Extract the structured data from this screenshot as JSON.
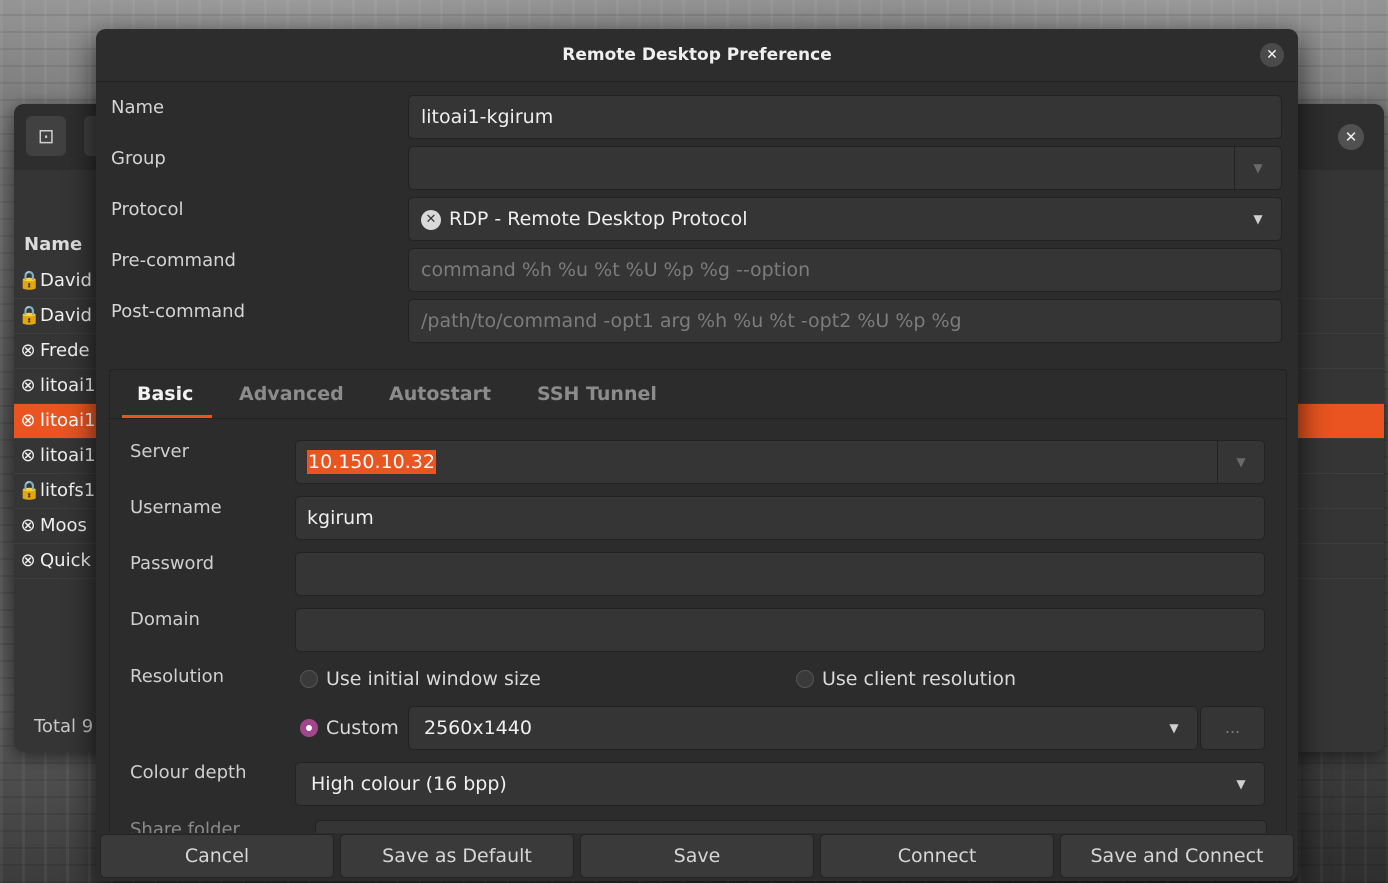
{
  "main_window": {
    "column_name": "Name",
    "rows": [
      {
        "icon": "🔒",
        "label": "David",
        "selected": false
      },
      {
        "icon": "🔒",
        "label": "David",
        "selected": false
      },
      {
        "icon": "⊗",
        "label": "Frede",
        "selected": false
      },
      {
        "icon": "⊗",
        "label": "litoai1",
        "selected": false
      },
      {
        "icon": "⊗",
        "label": "litoai1",
        "selected": true
      },
      {
        "icon": "⊗",
        "label": "litoai1",
        "selected": false
      },
      {
        "icon": "🔒",
        "label": "litofs1",
        "selected": false
      },
      {
        "icon": "⊗",
        "label": "Moos",
        "selected": false
      },
      {
        "icon": "⊗",
        "label": "Quick",
        "selected": false
      }
    ],
    "status": "Total 9"
  },
  "dialog": {
    "title": "Remote Desktop Preference",
    "fields": {
      "name_label": "Name",
      "name_value": "litoai1-kgirum",
      "group_label": "Group",
      "group_value": "",
      "protocol_label": "Protocol",
      "protocol_value": "RDP - Remote Desktop Protocol",
      "precommand_label": "Pre-command",
      "precommand_placeholder": "command %h %u %t %U %p %g --option",
      "postcommand_label": "Post-command",
      "postcommand_placeholder": "/path/to/command -opt1 arg %h %u %t -opt2 %U %p %g"
    },
    "tabs": [
      {
        "label": "Basic",
        "active": true
      },
      {
        "label": "Advanced",
        "active": false
      },
      {
        "label": "Autostart",
        "active": false
      },
      {
        "label": "SSH Tunnel",
        "active": false
      }
    ],
    "basic": {
      "server_label": "Server",
      "server_value": "10.150.10.32",
      "username_label": "Username",
      "username_value": "kgirum",
      "password_label": "Password",
      "password_value": "",
      "domain_label": "Domain",
      "domain_value": "",
      "resolution_label": "Resolution",
      "res_option_initial": "Use initial window size",
      "res_option_client": "Use client resolution",
      "res_option_custom": "Custom",
      "custom_resolution": "2560x1440",
      "custom_more": "...",
      "colour_depth_label": "Colour depth",
      "colour_depth_value": "High colour (16 bpp)",
      "share_folder_label": "Share folder"
    },
    "buttons": {
      "cancel": "Cancel",
      "save_default": "Save as Default",
      "save": "Save",
      "connect": "Connect",
      "save_connect": "Save and Connect"
    }
  },
  "colors": {
    "accent": "#e95420",
    "radio_selected": "#a2468b",
    "dialog_bg": "#2c2c2c"
  }
}
